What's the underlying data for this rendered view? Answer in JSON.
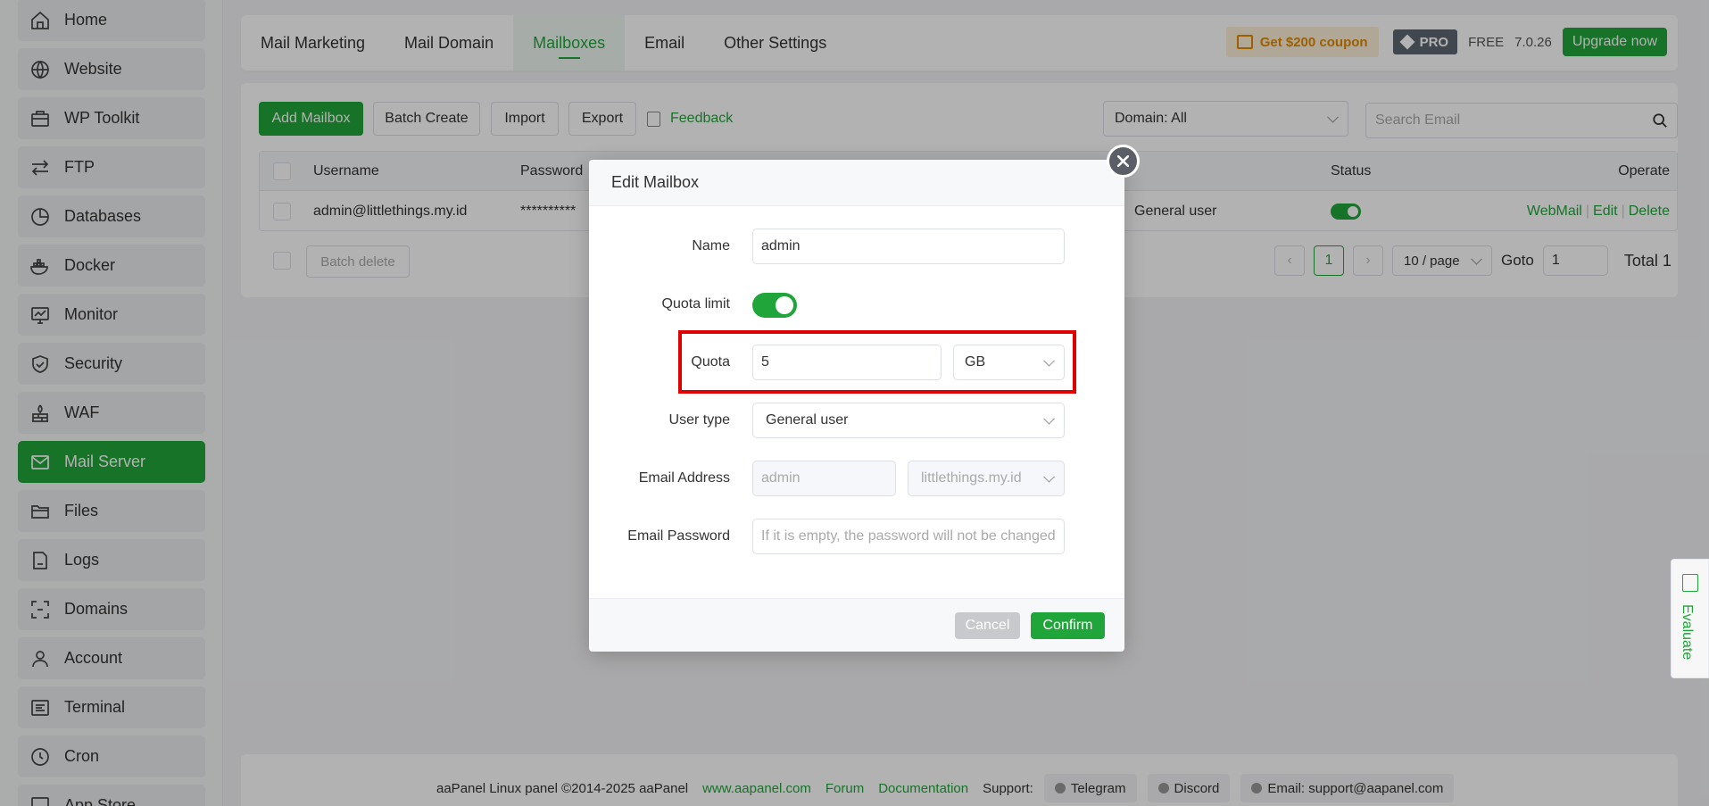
{
  "sidebar": {
    "items": [
      {
        "label": "Home",
        "icon": "home-icon"
      },
      {
        "label": "Website",
        "icon": "globe-icon"
      },
      {
        "label": "WP Toolkit",
        "icon": "toolkit-icon"
      },
      {
        "label": "FTP",
        "icon": "ftp-arrows-icon"
      },
      {
        "label": "Databases",
        "icon": "database-icon"
      },
      {
        "label": "Docker",
        "icon": "docker-icon"
      },
      {
        "label": "Monitor",
        "icon": "monitor-icon"
      },
      {
        "label": "Security",
        "icon": "shield-icon"
      },
      {
        "label": "WAF",
        "icon": "firewall-icon"
      },
      {
        "label": "Mail Server",
        "icon": "mail-icon"
      },
      {
        "label": "Files",
        "icon": "folder-icon"
      },
      {
        "label": "Logs",
        "icon": "logs-icon"
      },
      {
        "label": "Domains",
        "icon": "domains-icon"
      },
      {
        "label": "Account",
        "icon": "user-icon"
      },
      {
        "label": "Terminal",
        "icon": "terminal-icon"
      },
      {
        "label": "Cron",
        "icon": "clock-icon"
      },
      {
        "label": "App Store",
        "icon": "store-icon"
      }
    ],
    "active": "Mail Server"
  },
  "header": {
    "tabs": [
      "Mail Marketing",
      "Mail Domain",
      "Mailboxes",
      "Email",
      "Other Settings"
    ],
    "active_tab": "Mailboxes",
    "coupon": "Get $200 coupon",
    "pro": "PRO",
    "free": "FREE",
    "version": "7.0.26",
    "upgrade": "Upgrade now"
  },
  "toolbar": {
    "add_mailbox": "Add Mailbox",
    "batch_create": "Batch Create",
    "import": "Import",
    "export": "Export",
    "feedback": "Feedback",
    "domain_filter": "Domain: All",
    "search_placeholder": "Search Email"
  },
  "table": {
    "columns": {
      "username": "Username",
      "password": "Password",
      "status": "Status",
      "operate": "Operate"
    },
    "rows": [
      {
        "username": "admin@littlethings.my.id",
        "password": "**********",
        "user_type": "General user",
        "status_on": true
      }
    ],
    "actions": {
      "webmail": "WebMail",
      "edit": "Edit",
      "delete": "Delete"
    },
    "batch_delete": "Batch delete"
  },
  "pagination": {
    "current_page": "1",
    "per_page": "10 / page",
    "goto_label": "Goto",
    "goto_value": "1",
    "total": "Total 1"
  },
  "footer": {
    "copyright": "aaPanel Linux panel ©2014-2025 aaPanel",
    "site": "www.aapanel.com",
    "forum": "Forum",
    "docs": "Documentation",
    "support": "Support:",
    "telegram": "Telegram",
    "discord": "Discord",
    "email": "Email: support@aapanel.com"
  },
  "evaluate": "Evaluate",
  "modal": {
    "title": "Edit Mailbox",
    "name_label": "Name",
    "name_value": "admin",
    "quota_limit_label": "Quota limit",
    "quota_limit_on": true,
    "quota_label": "Quota",
    "quota_value": "5",
    "quota_unit": "GB",
    "user_type_label": "User type",
    "user_type_value": "General user",
    "email_address_label": "Email Address",
    "email_local": "admin",
    "email_domain": "littlethings.my.id",
    "email_password_label": "Email Password",
    "email_password_placeholder": "If it is empty, the password will not be changed",
    "cancel": "Cancel",
    "confirm": "Confirm"
  },
  "colors": {
    "accent": "#20a53a",
    "highlight": "#e00000",
    "coupon": "#e08a00"
  }
}
